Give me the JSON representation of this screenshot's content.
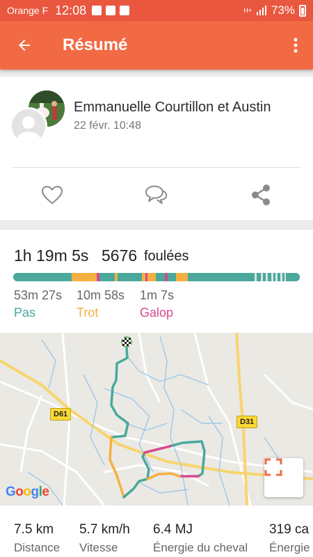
{
  "status_bar": {
    "carrier": "Orange F",
    "time": "12:08",
    "network": "H+",
    "battery": "73%"
  },
  "app_bar": {
    "title": "Résumé"
  },
  "activity": {
    "name": "Emmanuelle Courtillon et Austin",
    "date": "22 févr. 10:48",
    "actions": [
      "heart-icon",
      "comment-icon",
      "share-icon"
    ]
  },
  "summary": {
    "duration_h": "1h",
    "duration_m": "19m",
    "duration_s": "5s",
    "strides_count": "5676",
    "strides_label": "foulées"
  },
  "gaits": [
    {
      "time": "53m 27s",
      "label": "Pas",
      "color": "#4aa89c"
    },
    {
      "time": "10m 58s",
      "label": "Trot",
      "color": "#f5b041"
    },
    {
      "time": "1m 7s",
      "label": "Galop",
      "color": "#d9498f"
    }
  ],
  "map": {
    "roads": [
      "D61",
      "D31"
    ],
    "attribution": "Google"
  },
  "metrics": [
    {
      "value": "7.5 km",
      "label": "Distance"
    },
    {
      "value": "5.7 km/h",
      "label": "Vitesse"
    },
    {
      "value": "6.4 MJ",
      "label": "Énergie du cheval"
    },
    {
      "value": "319 ca",
      "label": "Énergie"
    }
  ],
  "colors": {
    "statusbar": "#e9573f",
    "appbar": "#f26a44",
    "walk": "#4aa89c",
    "trot": "#f5b041",
    "canter": "#d9498f"
  }
}
